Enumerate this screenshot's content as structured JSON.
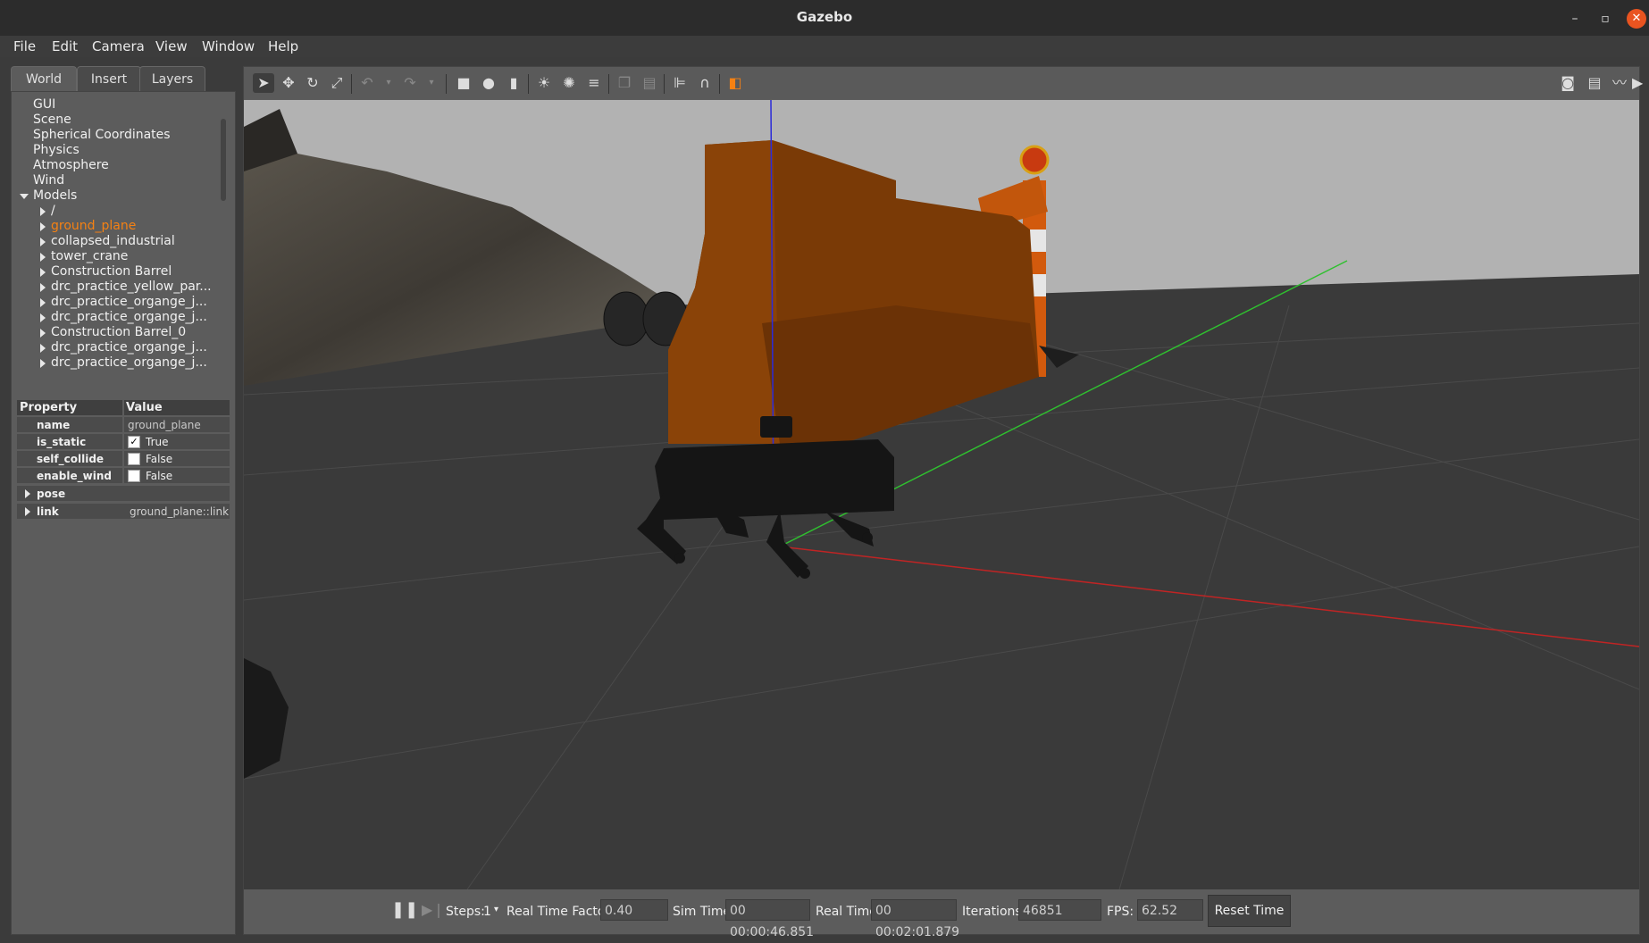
{
  "window": {
    "title": "Gazebo"
  },
  "menu": [
    "File",
    "Edit",
    "Camera",
    "View",
    "Window",
    "Help"
  ],
  "left_panel": {
    "tabs": [
      "World",
      "Insert",
      "Layers"
    ],
    "active_tab": "World",
    "tree": [
      {
        "label": "GUI",
        "level": 0,
        "expandable": false
      },
      {
        "label": "Scene",
        "level": 0,
        "expandable": false
      },
      {
        "label": "Spherical Coordinates",
        "level": 0,
        "expandable": false
      },
      {
        "label": "Physics",
        "level": 0,
        "expandable": false
      },
      {
        "label": "Atmosphere",
        "level": 0,
        "expandable": false
      },
      {
        "label": "Wind",
        "level": 0,
        "expandable": false
      },
      {
        "label": "Models",
        "level": 0,
        "expandable": true,
        "expanded": true
      },
      {
        "label": "/",
        "level": 1,
        "expandable": true
      },
      {
        "label": "ground_plane",
        "level": 1,
        "expandable": true,
        "selected": true
      },
      {
        "label": "collapsed_industrial",
        "level": 1,
        "expandable": true
      },
      {
        "label": "tower_crane",
        "level": 1,
        "expandable": true
      },
      {
        "label": "Construction Barrel",
        "level": 1,
        "expandable": true
      },
      {
        "label": "drc_practice_yellow_par...",
        "level": 1,
        "expandable": true
      },
      {
        "label": "drc_practice_organge_j...",
        "level": 1,
        "expandable": true
      },
      {
        "label": "drc_practice_organge_j...",
        "level": 1,
        "expandable": true
      },
      {
        "label": "Construction Barrel_0",
        "level": 1,
        "expandable": true
      },
      {
        "label": "drc_practice_organge_j...",
        "level": 1,
        "expandable": true
      },
      {
        "label": "drc_practice_organge_j...",
        "level": 1,
        "expandable": true
      }
    ],
    "property_header": {
      "property": "Property",
      "value": "Value"
    },
    "properties": [
      {
        "name": "name",
        "value": "ground_plane",
        "checkbox": false
      },
      {
        "name": "is_static",
        "value": "True",
        "checkbox": true,
        "checked": true
      },
      {
        "name": "self_collide",
        "value": "False",
        "checkbox": true,
        "checked": false
      },
      {
        "name": "enable_wind",
        "value": "False",
        "checkbox": true,
        "checked": false
      },
      {
        "name": "pose",
        "value": "",
        "expandable": true
      },
      {
        "name": "link",
        "value": "ground_plane::link",
        "expandable": true
      }
    ]
  },
  "bottom_bar": {
    "steps_label": "Steps:",
    "steps_value": "1",
    "rtf_label": "Real Time Factor:",
    "rtf_value": "0.40",
    "sim_time_label": "Sim Time:",
    "sim_time_value": "00 00:00:46.851",
    "real_time_label": "Real Time:",
    "real_time_value": "00 00:02:01.879",
    "iterations_label": "Iterations:",
    "iterations_value": "46851",
    "fps_label": "FPS:",
    "fps_value": "62.52",
    "reset_label": "Reset Time"
  },
  "colors": {
    "accent": "#f58113",
    "barrier": "#7a3a06",
    "sky": "#b0b0b0",
    "ground": "#3a3a3a",
    "axis_x": "#c02020",
    "axis_y": "#20c020",
    "axis_z": "#2020c0"
  }
}
